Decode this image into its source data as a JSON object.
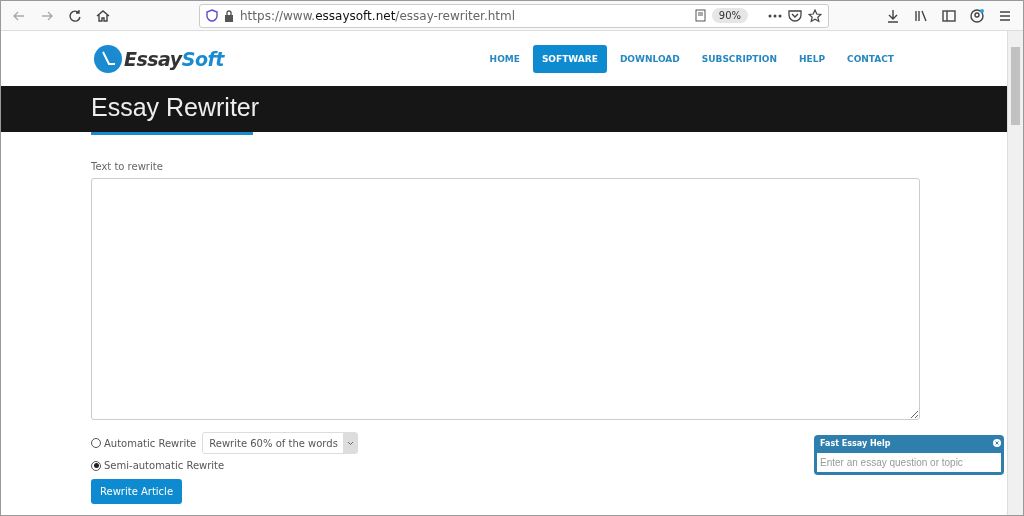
{
  "browser": {
    "url": "https://www.**essaysoft.net**/essay-rewriter.html",
    "zoom": "90%"
  },
  "logo": {
    "first": "Essay",
    "second": "Soft"
  },
  "nav": [
    {
      "label": "HOME",
      "selected": false
    },
    {
      "label": "SOFTWARE",
      "selected": true
    },
    {
      "label": "DOWNLOAD",
      "selected": false
    },
    {
      "label": "SUBSCRIPTION",
      "selected": false
    },
    {
      "label": "HELP",
      "selected": false
    },
    {
      "label": "CONTACT",
      "selected": false
    }
  ],
  "banner": {
    "title": "Essay Rewriter"
  },
  "form": {
    "label": "Text to rewrite",
    "options": [
      {
        "label": "Automatic Rewrite",
        "selected": false,
        "dropdown": "Rewrite 60% of the words"
      },
      {
        "label": "Semi-automatic Rewrite",
        "selected": true
      }
    ],
    "button": "Rewrite Article"
  },
  "help_widget": {
    "title": "Fast Essay Help",
    "placeholder": "Enter an essay question or topic"
  }
}
